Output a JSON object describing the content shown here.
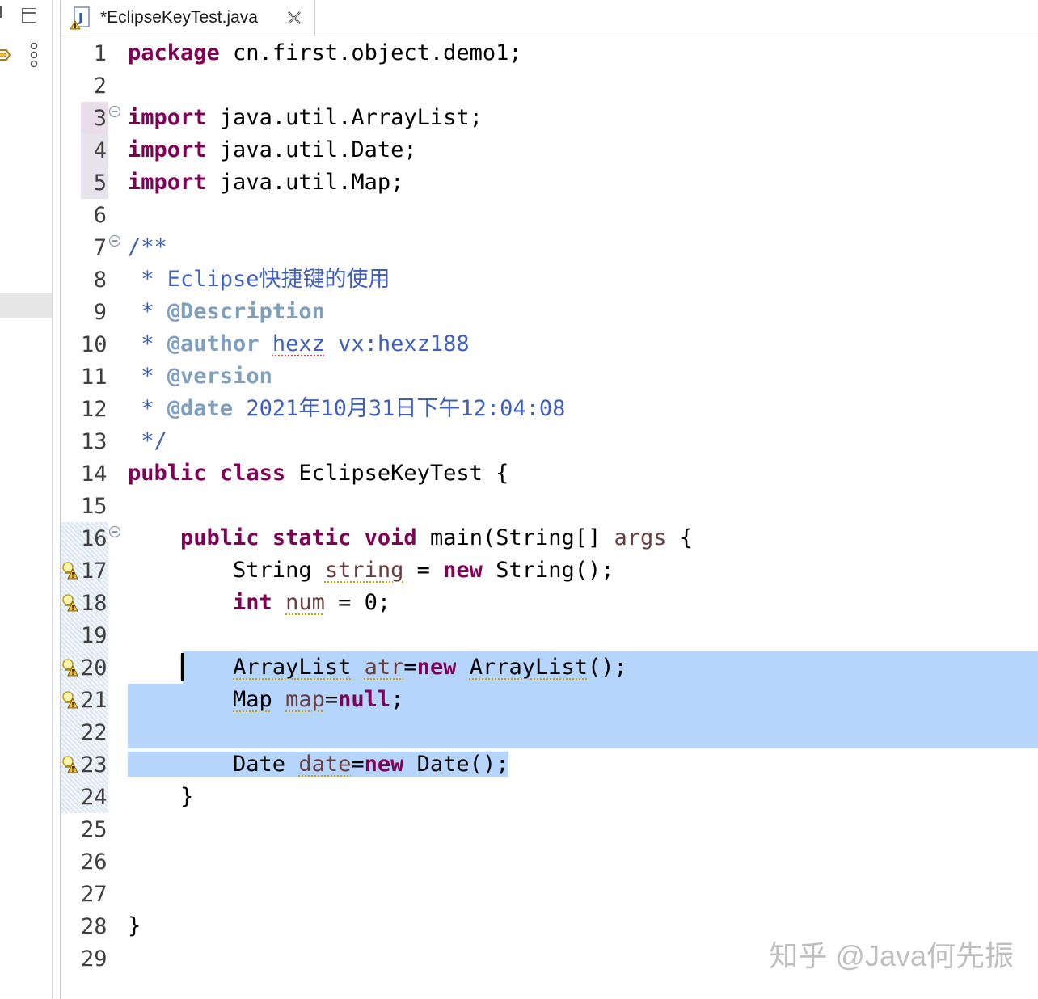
{
  "tab": {
    "file_name": "*EclipseKeyTest.java",
    "file_type": "java-source"
  },
  "selection_color": "#b5d5fc",
  "code_lines": [
    {
      "n": "1",
      "segs": [
        [
          "kw",
          "package"
        ],
        [
          "",
          "cn.first.object.demo1;"
        ]
      ]
    },
    {
      "n": "2",
      "segs": []
    },
    {
      "n": "3",
      "fold": true,
      "segs": [
        [
          "kw",
          "import"
        ],
        [
          "",
          " java.util.ArrayList;"
        ]
      ]
    },
    {
      "n": "4",
      "segs": [
        [
          "kw",
          "import"
        ],
        [
          "",
          " java.util.Date;"
        ]
      ]
    },
    {
      "n": "5",
      "segs": [
        [
          "kw",
          "import"
        ],
        [
          "",
          " java.util.Map;"
        ]
      ]
    },
    {
      "n": "6",
      "segs": []
    },
    {
      "n": "7",
      "fold": true,
      "segs": [
        [
          "cm",
          "/**"
        ]
      ]
    },
    {
      "n": "8",
      "segs": [
        [
          "cm",
          " * Eclipse快捷键的使用"
        ]
      ]
    },
    {
      "n": "9",
      "segs": [
        [
          "cm",
          " * "
        ],
        [
          "tag",
          "@Description"
        ]
      ]
    },
    {
      "n": "10",
      "segs": [
        [
          "cm",
          " * "
        ],
        [
          "tag",
          "@author"
        ],
        [
          "cm",
          " "
        ],
        [
          "cm spell",
          "hexz"
        ],
        [
          "cm",
          " vx:hexz188"
        ]
      ]
    },
    {
      "n": "11",
      "segs": [
        [
          "cm",
          " * "
        ],
        [
          "tag",
          "@version"
        ]
      ]
    },
    {
      "n": "12",
      "segs": [
        [
          "cm",
          " * "
        ],
        [
          "tag",
          "@date"
        ],
        [
          "cm",
          " 2021年10月31日下午12:04:08"
        ]
      ]
    },
    {
      "n": "13",
      "segs": [
        [
          "cm",
          " */"
        ]
      ]
    },
    {
      "n": "14",
      "segs": [
        [
          "kw",
          "public"
        ],
        [
          "",
          " "
        ],
        [
          "kw",
          "class"
        ],
        [
          "",
          " EclipseKeyTest {"
        ]
      ]
    },
    {
      "n": "15",
      "segs": []
    },
    {
      "n": "16",
      "fold": true,
      "segs": [
        [
          "",
          "    "
        ],
        [
          "kw",
          "public"
        ],
        [
          "",
          " "
        ],
        [
          "kw",
          "static"
        ],
        [
          "",
          " "
        ],
        [
          "kw",
          "void"
        ],
        [
          "",
          " main(String[] "
        ],
        [
          "var",
          "args"
        ],
        [
          "",
          " {"
        ]
      ]
    },
    {
      "n": "17",
      "warning": true,
      "segs": [
        [
          "",
          "        String "
        ],
        [
          "var warn",
          "string"
        ],
        [
          "",
          " = "
        ],
        [
          "kw",
          "new"
        ],
        [
          "",
          " String();"
        ]
      ]
    },
    {
      "n": "18",
      "warning": true,
      "segs": [
        [
          "",
          "        "
        ],
        [
          "kw",
          "int"
        ],
        [
          "",
          " "
        ],
        [
          "var warn",
          "num"
        ],
        [
          "",
          " = 0;"
        ]
      ]
    },
    {
      "n": "19",
      "segs": []
    },
    {
      "n": "20",
      "warning": true,
      "caret": true,
      "sel_from": 5,
      "segs": [
        [
          "",
          "    "
        ],
        [
          "sel",
          "    "
        ],
        [
          "sel warn",
          "ArrayList"
        ],
        [
          "sel",
          " "
        ],
        [
          "sel var warn",
          "atr"
        ],
        [
          "sel",
          "="
        ],
        [
          "sel kw",
          "new"
        ],
        [
          "sel",
          " "
        ],
        [
          "sel warn",
          "ArrayList"
        ],
        [
          "sel",
          "();"
        ]
      ],
      "full_sel": true
    },
    {
      "n": "21",
      "warning": true,
      "full_sel": true,
      "segs": [
        [
          "sel",
          "        "
        ],
        [
          "sel warn",
          "Map"
        ],
        [
          "sel",
          " "
        ],
        [
          "sel var warn",
          "map"
        ],
        [
          "sel",
          "="
        ],
        [
          "sel kw",
          "null"
        ],
        [
          "sel",
          ";"
        ]
      ]
    },
    {
      "n": "22",
      "full_sel": true,
      "segs": [
        [
          "sel",
          " "
        ]
      ]
    },
    {
      "n": "23",
      "warning": true,
      "segs": [
        [
          "sel",
          "        Date "
        ],
        [
          "sel var warn",
          "date"
        ],
        [
          "sel",
          "="
        ],
        [
          "sel kw",
          "new"
        ],
        [
          "sel",
          " Date();"
        ]
      ]
    },
    {
      "n": "24",
      "segs": [
        [
          "",
          "    }"
        ]
      ]
    },
    {
      "n": "25",
      "segs": []
    },
    {
      "n": "26",
      "segs": []
    },
    {
      "n": "27",
      "segs": []
    },
    {
      "n": "28",
      "segs": [
        [
          "",
          "}"
        ]
      ]
    },
    {
      "n": "29",
      "segs": []
    }
  ],
  "watermark": "知乎 @Java何先振"
}
